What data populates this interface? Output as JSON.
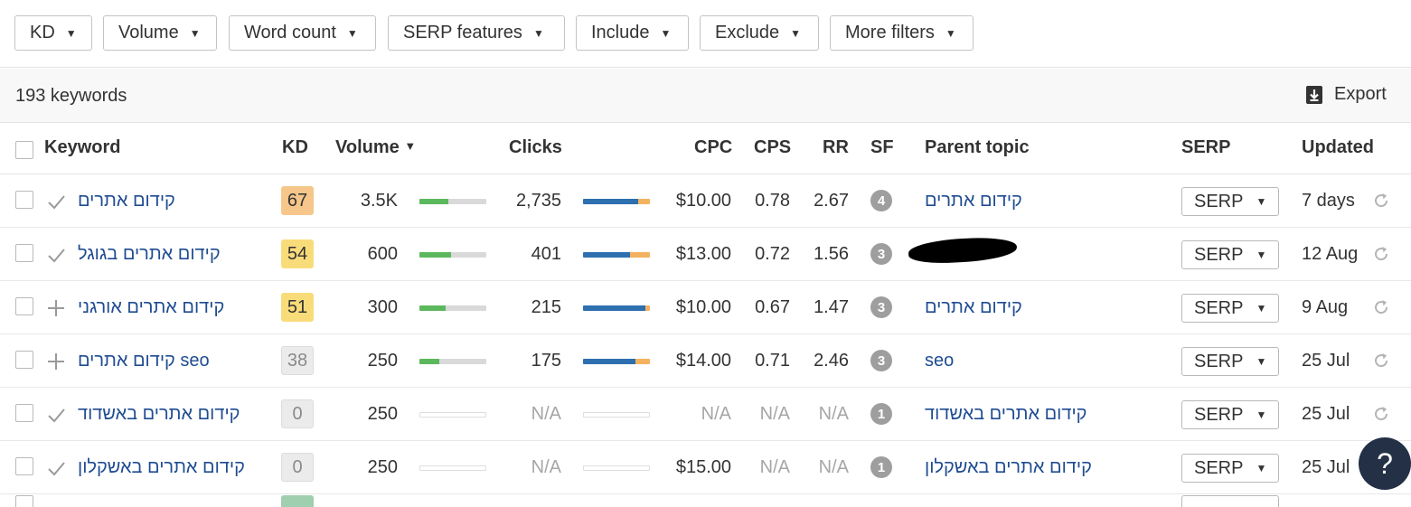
{
  "filters": [
    {
      "label": "KD"
    },
    {
      "label": "Volume"
    },
    {
      "label": "Word count"
    },
    {
      "label": "SERP features"
    },
    {
      "label": "Include"
    },
    {
      "label": "Exclude"
    },
    {
      "label": "More filters"
    }
  ],
  "summary": {
    "count_label": "193 keywords",
    "export_label": "Export"
  },
  "columns": {
    "keyword": "Keyword",
    "kd": "KD",
    "volume": "Volume",
    "clicks": "Clicks",
    "cpc": "CPC",
    "cps": "CPS",
    "rr": "RR",
    "sf": "SF",
    "parent_topic": "Parent topic",
    "serp": "SERP",
    "updated": "Updated"
  },
  "colors": {
    "link": "#1f4c91",
    "kd_orange": "#f6c68a",
    "kd_yellow": "#f9dc7a",
    "kd_gray": "#ebebeb",
    "bar_green": "#5cb85c",
    "bar_gray": "#d9d9d9",
    "clicks_blue": "#2e6fb0",
    "clicks_orange": "#f3b25f",
    "sf_badge": "#9e9e9e",
    "help_bg": "#233046"
  },
  "rows": [
    {
      "mark": "check",
      "keyword": "קידום אתרים",
      "kd": "67",
      "kd_color": "#f6c68a",
      "volume": "3.5K",
      "volume_fill": 0.43,
      "clicks": "2,735",
      "clicks_blue": 0.83,
      "clicks_orange": 0.17,
      "clicks_na": false,
      "cpc": "$10.00",
      "cps": "0.78",
      "rr": "2.67",
      "sf": "4",
      "parent_topic": "קידום אתרים",
      "serp": "SERP",
      "updated": "7 days"
    },
    {
      "mark": "check",
      "keyword": "קידום אתרים בגוגל",
      "kd": "54",
      "kd_color": "#f9dc7a",
      "volume": "600",
      "volume_fill": 0.47,
      "clicks": "401",
      "clicks_blue": 0.7,
      "clicks_orange": 0.3,
      "clicks_na": false,
      "cpc": "$13.00",
      "cps": "0.72",
      "rr": "1.56",
      "sf": "3",
      "parent_topic": "",
      "serp": "SERP",
      "updated": "12 Aug"
    },
    {
      "mark": "plus",
      "keyword": "קידום אתרים אורגני",
      "kd": "51",
      "kd_color": "#f9dc7a",
      "volume": "300",
      "volume_fill": 0.39,
      "clicks": "215",
      "clicks_blue": 0.93,
      "clicks_orange": 0.07,
      "clicks_na": false,
      "cpc": "$10.00",
      "cps": "0.67",
      "rr": "1.47",
      "sf": "3",
      "parent_topic": "קידום אתרים",
      "serp": "SERP",
      "updated": "9 Aug"
    },
    {
      "mark": "plus",
      "keyword": "קידום אתרים seo",
      "kd": "38",
      "kd_color": "#ebebeb",
      "volume": "250",
      "volume_fill": 0.3,
      "clicks": "175",
      "clicks_blue": 0.78,
      "clicks_orange": 0.22,
      "clicks_na": false,
      "cpc": "$14.00",
      "cps": "0.71",
      "rr": "2.46",
      "sf": "3",
      "parent_topic": "seo",
      "serp": "SERP",
      "updated": "25 Jul"
    },
    {
      "mark": "check",
      "keyword": "קידום אתרים באשדוד",
      "kd": "0",
      "kd_color": "#ebebeb",
      "volume": "250",
      "volume_fill": 0,
      "clicks": "N/A",
      "clicks_blue": 0,
      "clicks_orange": 0,
      "clicks_na": true,
      "cpc": "N/A",
      "cps": "N/A",
      "rr": "N/A",
      "sf": "1",
      "parent_topic": "קידום אתרים באשדוד",
      "serp": "SERP",
      "updated": "25 Jul"
    },
    {
      "mark": "check",
      "keyword": "קידום אתרים באשקלון",
      "kd": "0",
      "kd_color": "#ebebeb",
      "volume": "250",
      "volume_fill": 0,
      "clicks": "N/A",
      "clicks_blue": 0,
      "clicks_orange": 0,
      "clicks_na": true,
      "cpc": "$15.00",
      "cps": "N/A",
      "rr": "N/A",
      "sf": "1",
      "parent_topic": "קידום אתרים באשקלון",
      "serp": "SERP",
      "updated": "25 Jul"
    }
  ],
  "help": {
    "label": "?"
  }
}
